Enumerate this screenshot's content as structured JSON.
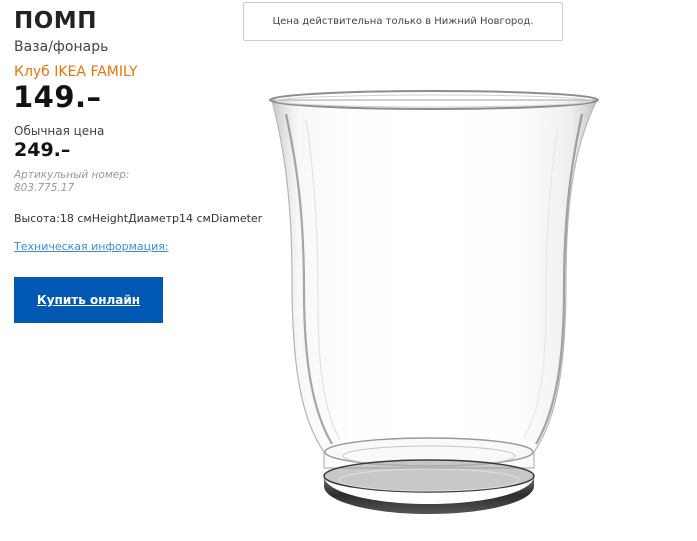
{
  "product": {
    "name": "ПОМП",
    "type": "Ваза/фонарь",
    "family_label": "Клуб IKEA FAMILY",
    "family_price": "149.–",
    "regular_label": "Обычная цена",
    "regular_price": "249.–",
    "article_number": "Артикульный номер: 803.775.17",
    "dimensions": "Высота:18 смHeightДиаметр14 смDiameter",
    "tech_info_link": "Техническая информация:",
    "buy_button": "Купить онлайн"
  },
  "notice": {
    "text": "Цена действительна только в Нижний Новгород."
  },
  "colors": {
    "family_accent": "#e8750a",
    "buy_button_bg": "#0058b3",
    "link": "#3a8fd6"
  }
}
